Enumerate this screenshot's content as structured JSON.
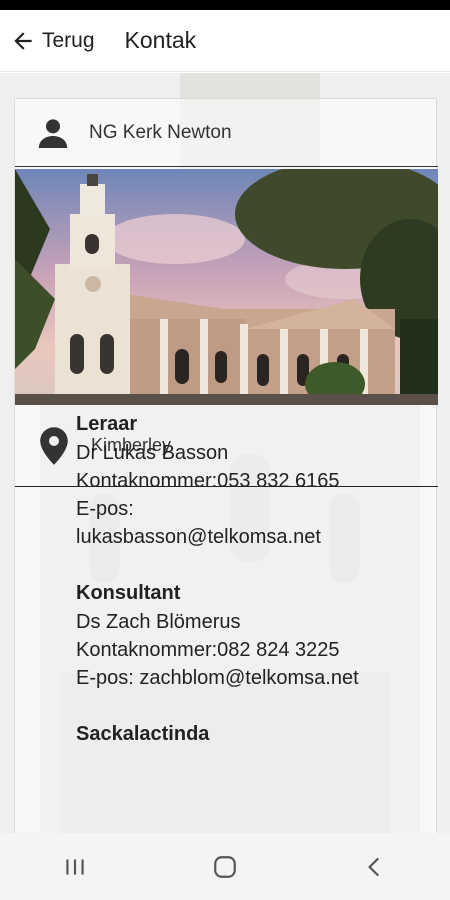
{
  "header": {
    "back_label": "Terug",
    "title": "Kontak"
  },
  "church": {
    "name": "NG Kerk Newton",
    "location": "Kimberley"
  },
  "contacts": [
    {
      "role": "Leraar",
      "name": "Dr Lukas Basson",
      "phone_line": "Kontaknommer:053 832 6165",
      "email_label": "E-pos:",
      "email": "lukasbasson@telkomsa.net"
    },
    {
      "role": "Konsultant",
      "name": "Ds Zach Blömerus",
      "phone_line": "Kontaknommer:082 824 3225",
      "email_line": "E-pos: zachblom@telkomsa.net"
    },
    {
      "role": "Sackalactinda"
    }
  ],
  "icons": {
    "back": "arrow-left-icon",
    "person": "person-icon",
    "location": "location-pin-icon",
    "nav_recents": "recents-icon",
    "nav_home": "home-icon",
    "nav_back": "nav-back-icon"
  }
}
